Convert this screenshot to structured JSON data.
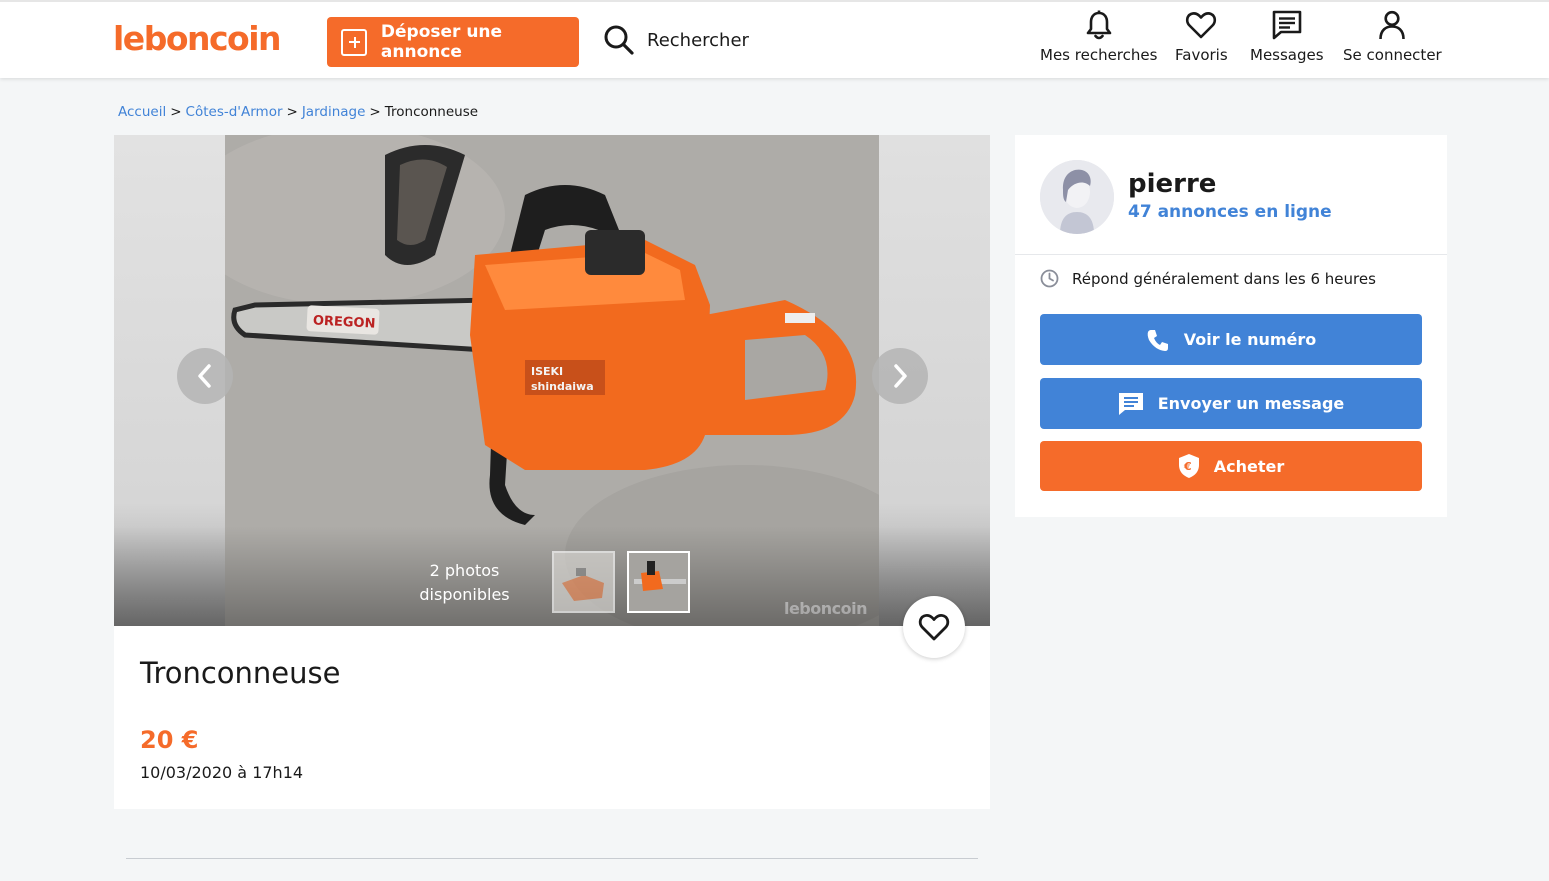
{
  "brand": {
    "logo_text": "leboncoin",
    "accent_color": "#f56b2a",
    "link_color": "#4183d7"
  },
  "header": {
    "post_ad_label": "Déposer une annonce",
    "search_label": "Rechercher",
    "nav": [
      {
        "label": "Mes recherches",
        "icon": "bell-icon"
      },
      {
        "label": "Favoris",
        "icon": "heart-icon"
      },
      {
        "label": "Messages",
        "icon": "message-icon"
      },
      {
        "label": "Se connecter",
        "icon": "user-icon"
      }
    ]
  },
  "breadcrumb": {
    "items": [
      "Accueil",
      "Côtes-d'Armor",
      "Jardinage"
    ],
    "current": "Tronconneuse",
    "separator": ">"
  },
  "gallery": {
    "photos_count_line1": "2 photos",
    "photos_count_line2": "disponibles",
    "watermark": "leboncoin"
  },
  "listing": {
    "title": "Tronconneuse",
    "price": "20 €",
    "date": "10/03/2020 à 17h14"
  },
  "seller": {
    "name": "pierre",
    "ads_count": "47 annonces en ligne",
    "reply_time": "Répond généralement dans les 6 heures",
    "show_number_label": "Voir le numéro",
    "send_message_label": "Envoyer un message",
    "buy_label": "Acheter"
  }
}
